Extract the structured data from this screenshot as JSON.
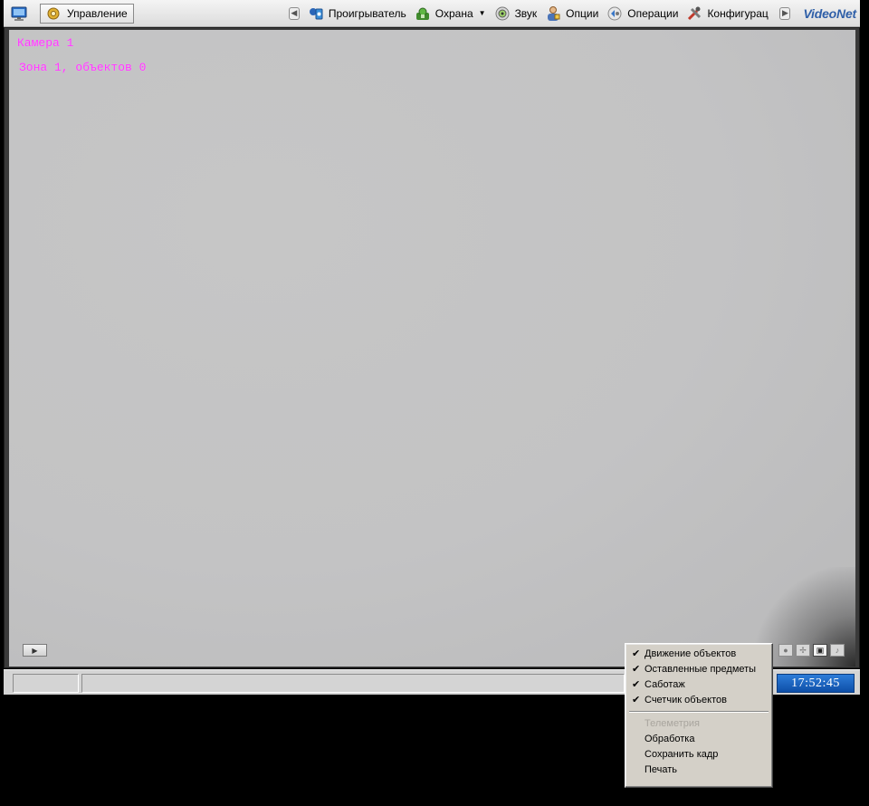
{
  "toolbar": {
    "manage_label": "Управление",
    "items": [
      {
        "label": "Проигрыватель",
        "icon": "player-icon"
      },
      {
        "label": "Охрана",
        "icon": "security-icon",
        "has_dropdown": true
      },
      {
        "label": "Звук",
        "icon": "sound-icon"
      },
      {
        "label": "Опции",
        "icon": "options-icon"
      },
      {
        "label": "Операции",
        "icon": "operations-icon"
      },
      {
        "label": "Конфигурация",
        "icon": "configuration-icon"
      }
    ],
    "brand": "VideoNet"
  },
  "video": {
    "camera_overlay": "Камера 1",
    "zone_overlay": "Зона 1, объектов 0"
  },
  "statusbar": {
    "clock": "17:52:45"
  },
  "context_menu": {
    "checked_items": [
      {
        "label": "Движение объектов",
        "checked": true
      },
      {
        "label": "Оставленные предметы",
        "checked": true
      },
      {
        "label": "Саботаж",
        "checked": true
      },
      {
        "label": "Счетчик объектов",
        "checked": true
      }
    ],
    "other_items": [
      {
        "label": "Телеметрия",
        "disabled": true
      },
      {
        "label": "Обработка",
        "disabled": false
      },
      {
        "label": "Сохранить кадр",
        "disabled": false
      },
      {
        "label": "Печать",
        "disabled": false
      }
    ]
  },
  "colors": {
    "osd_text": "#ff39ff",
    "clock_bg": "#1a5fbc",
    "brand": "#2f5fa8"
  }
}
